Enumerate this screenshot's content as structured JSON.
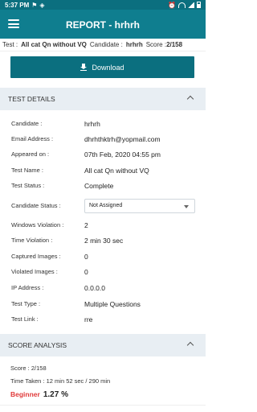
{
  "status_bar": {
    "time": "5:37 PM"
  },
  "app_bar": {
    "title": "REPORT - hrhrh"
  },
  "subheader": {
    "test_label": "Test :",
    "test_value": "All cat Qn without VQ",
    "candidate_label": "Candidate :",
    "candidate_value": "hrhrh",
    "score_label": "Score :",
    "score_value": "2/158"
  },
  "download": {
    "label": "Download"
  },
  "test_details": {
    "title": "TEST DETAILS",
    "rows": [
      {
        "label": "Candidate :",
        "value": "hrhrh"
      },
      {
        "label": "Email Address :",
        "value": "dhrhthktrh@yopmail.com"
      },
      {
        "label": "Appeared on :",
        "value": "07th Feb, 2020 04:55 pm"
      },
      {
        "label": "Test Name :",
        "value": "All cat Qn without VQ"
      },
      {
        "label": "Test Status :",
        "value": "Complete"
      },
      {
        "label": "Candidate Status :",
        "value": "Not Assigned"
      },
      {
        "label": "Windows Violation :",
        "value": "2"
      },
      {
        "label": "Time Violation :",
        "value": "2 min 30 sec"
      },
      {
        "label": "Captured Images :",
        "value": "0"
      },
      {
        "label": "Violated Images :",
        "value": "0"
      },
      {
        "label": "IP Address :",
        "value": "0.0.0.0"
      },
      {
        "label": "Test Type :",
        "value": "Multiple Questions"
      },
      {
        "label": "Test Link :",
        "value": "rre"
      }
    ]
  },
  "score_analysis": {
    "title": "SCORE ANALYSIS",
    "score_line": "Score : 2/158",
    "time_taken": "Time Taken : 12 min 52 sec  / 290 min",
    "grade": "Beginner",
    "percent": "1.27 %"
  }
}
